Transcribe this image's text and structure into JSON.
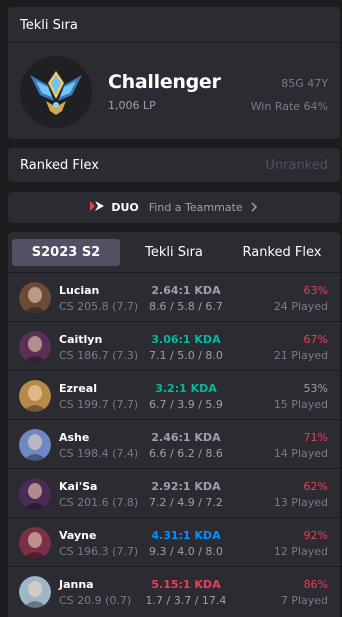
{
  "solo": {
    "title": "Tekli Sıra",
    "tier": "Challenger",
    "lp": "1,006 LP",
    "games": "85G 47Y",
    "win_rate": "Win Rate 64%"
  },
  "flex": {
    "title": "Ranked Flex",
    "status": "Unranked"
  },
  "duo": {
    "badge": "DUO",
    "label": "Find a Teammate"
  },
  "tabs": [
    "S2023 S2",
    "Tekli Sıra",
    "Ranked Flex"
  ],
  "champions": [
    {
      "name": "Lucian",
      "cs": "CS 205.8 (7.7)",
      "kda": "2.64:1 KDA",
      "kda_detail": "8.6 / 5.8 / 6.7",
      "win_rate": "63%",
      "played": "24 Played",
      "kda_color": "#9e9eb1",
      "wr_color": "#e84057",
      "avatar_color": "#6b4a3a"
    },
    {
      "name": "Caitlyn",
      "cs": "CS 186.7 (7.3)",
      "kda": "3.06:1 KDA",
      "kda_detail": "7.1 / 5.0 / 8.0",
      "win_rate": "67%",
      "played": "21 Played",
      "kda_color": "#00bba3",
      "wr_color": "#e84057",
      "avatar_color": "#5a2f56"
    },
    {
      "name": "Ezreal",
      "cs": "CS 199.7 (7.7)",
      "kda": "3.2:1 KDA",
      "kda_detail": "6.7 / 3.9 / 5.9",
      "win_rate": "53%",
      "played": "15 Played",
      "kda_color": "#00bba3",
      "wr_color": "#9e9eb1",
      "avatar_color": "#b88a4a"
    },
    {
      "name": "Ashe",
      "cs": "CS 198.4 (7.4)",
      "kda": "2.46:1 KDA",
      "kda_detail": "6.6 / 6.2 / 8.6",
      "win_rate": "71%",
      "played": "14 Played",
      "kda_color": "#9e9eb1",
      "wr_color": "#e84057",
      "avatar_color": "#6d88c4"
    },
    {
      "name": "Kai'Sa",
      "cs": "CS 201.6 (7.8)",
      "kda": "2.92:1 KDA",
      "kda_detail": "7.2 / 4.9 / 7.2",
      "win_rate": "62%",
      "played": "13 Played",
      "kda_color": "#9e9eb1",
      "wr_color": "#e84057",
      "avatar_color": "#4b2a55"
    },
    {
      "name": "Vayne",
      "cs": "CS 196.3 (7.7)",
      "kda": "4.31:1 KDA",
      "kda_detail": "9.3 / 4.0 / 8.0",
      "win_rate": "92%",
      "played": "12 Played",
      "kda_color": "#0093ff",
      "wr_color": "#e84057",
      "avatar_color": "#7a3048"
    },
    {
      "name": "Janna",
      "cs": "CS 20.9 (0.7)",
      "kda": "5.15:1 KDA",
      "kda_detail": "1.7 / 3.7 / 17.4",
      "win_rate": "86%",
      "played": "7 Played",
      "kda_color": "#e84057",
      "wr_color": "#e84057",
      "avatar_color": "#9fb6c8"
    }
  ]
}
